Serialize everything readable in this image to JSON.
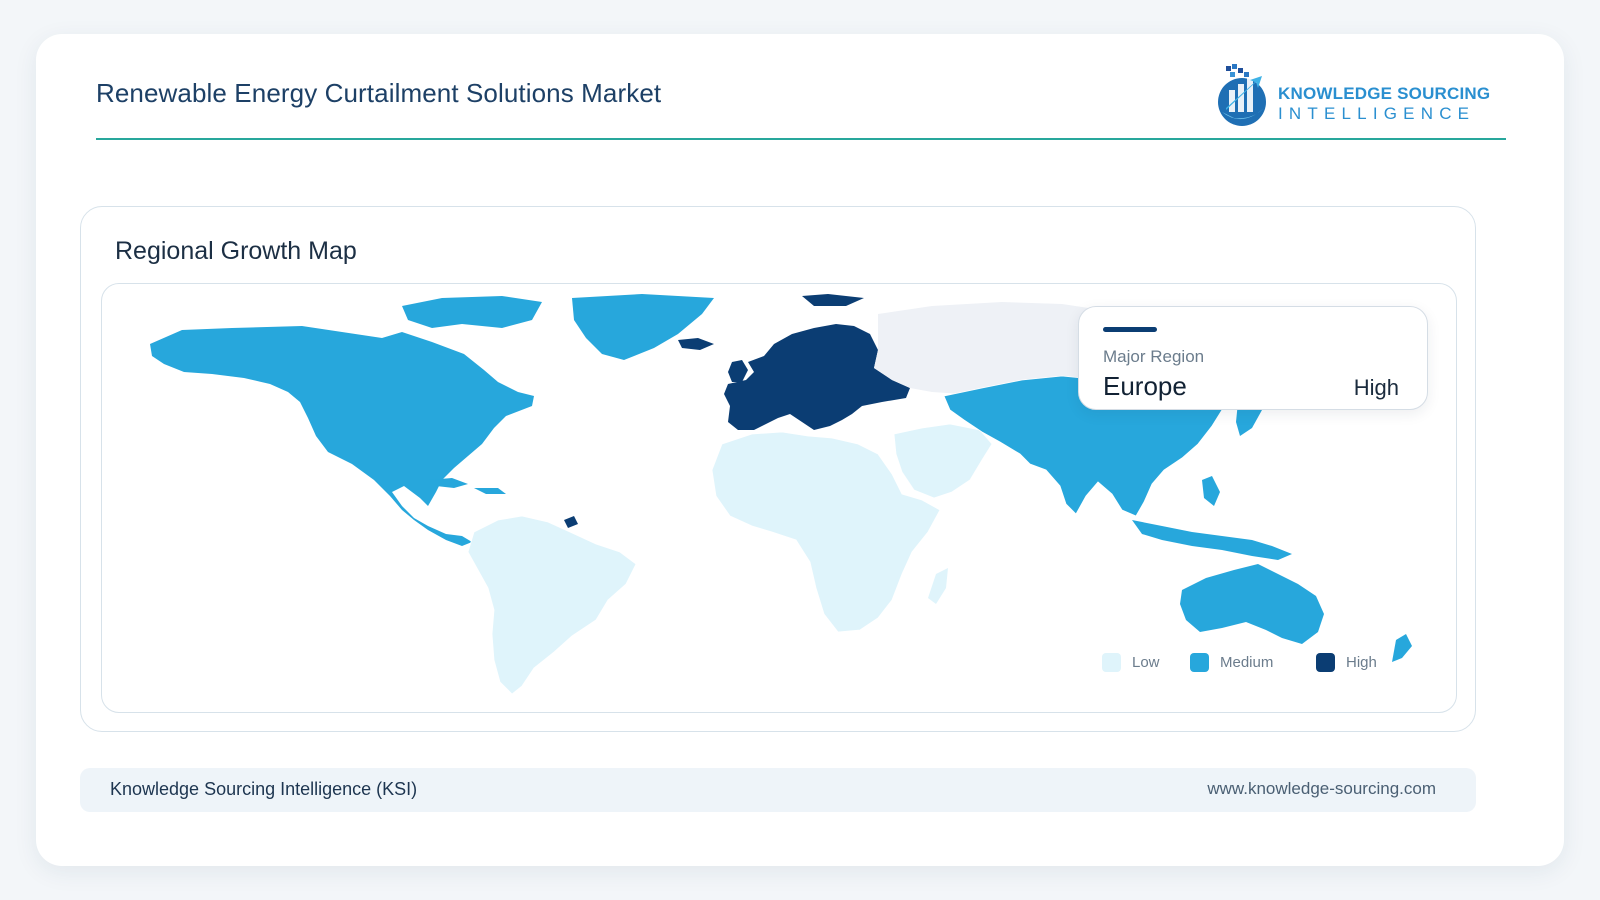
{
  "header": {
    "title": "Renewable Energy Curtailment Solutions Market",
    "logo_line1": "KNOWLEDGE SOURCING",
    "logo_line2": "INTELLIGENCE"
  },
  "panel": {
    "title": "Regional Growth Map"
  },
  "tooltip": {
    "label": "Major Region",
    "region": "Europe",
    "level": "High"
  },
  "legend": [
    {
      "label": "Low",
      "color": "#dff4fb"
    },
    {
      "label": "Medium",
      "color": "#27a7dc"
    },
    {
      "label": "High",
      "color": "#0b3d73"
    }
  ],
  "regions": [
    {
      "name": "North America",
      "level": "Medium"
    },
    {
      "name": "South America",
      "level": "Low"
    },
    {
      "name": "Europe",
      "level": "High"
    },
    {
      "name": "Middle East and Africa",
      "level": "Low"
    },
    {
      "name": "Asia Pacific",
      "level": "Medium"
    }
  ],
  "colors": {
    "low": "#dff4fb",
    "medium": "#27a7dc",
    "high": "#0b3d73",
    "other": "#eef1f6",
    "accent": "#28a79c"
  },
  "footer": {
    "left": "Knowledge Sourcing Intelligence (KSI)",
    "right": "www.knowledge-sourcing.com"
  }
}
